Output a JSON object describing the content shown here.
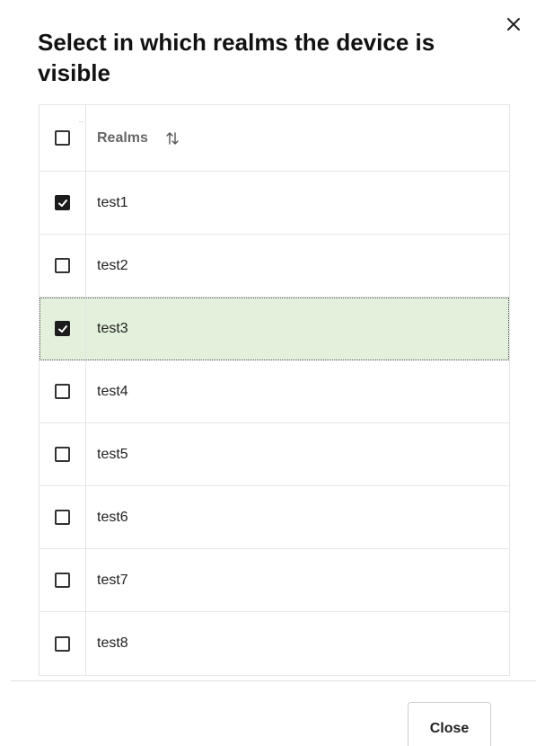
{
  "dialog": {
    "title": "Select in which realms the device is visible",
    "close_icon": "close-icon"
  },
  "table": {
    "column_header": "Realms",
    "sort_icon": "sort-icon",
    "select_all_checked": false,
    "rows": [
      {
        "name": "test1",
        "checked": true,
        "highlighted": false
      },
      {
        "name": "test2",
        "checked": false,
        "highlighted": false
      },
      {
        "name": "test3",
        "checked": true,
        "highlighted": true
      },
      {
        "name": "test4",
        "checked": false,
        "highlighted": false
      },
      {
        "name": "test5",
        "checked": false,
        "highlighted": false
      },
      {
        "name": "test6",
        "checked": false,
        "highlighted": false
      },
      {
        "name": "test7",
        "checked": false,
        "highlighted": false
      },
      {
        "name": "test8",
        "checked": false,
        "highlighted": false
      }
    ]
  },
  "footer": {
    "close_label": "Close"
  },
  "colors": {
    "selected_row_background": "#e3f1dc",
    "checkbox_checked": "#1c1c1c"
  }
}
